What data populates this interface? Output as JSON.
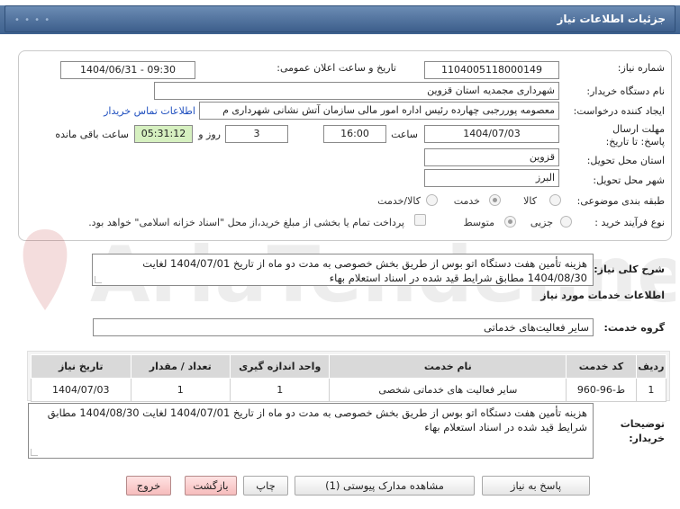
{
  "header": {
    "title": "جزئیات اطلاعات نیاز"
  },
  "fields": {
    "need_number_label": "شماره نیاز:",
    "need_number": "1104005118000149",
    "announce_label": "تاریخ و ساعت اعلان عمومی:",
    "announce_value": "1404/06/31 - 09:30",
    "buyer_org_label": "نام دستگاه خریدار:",
    "buyer_org": "شهرداری مجمدیه استان قزوین",
    "creator_label": "ایجاد کننده درخواست:",
    "creator": "معصومه پوررجبی چهارده رئیس اداره امور مالی سازمان آتش نشانی شهرداری م",
    "contact_link": "اطلاعات تماس خریدار",
    "deadline_label": "مهلت ارسال پاسخ: تا تاریخ:",
    "deadline_date": "1404/07/03",
    "time_label": "ساعت",
    "deadline_time": "16:00",
    "days_value": "3",
    "days_label": "روز و",
    "remaining_time": "05:31:12",
    "remaining_label": "ساعت باقی مانده",
    "province_label": "استان محل تحویل:",
    "province": "قزوین",
    "city_label": "شهر محل تحویل:",
    "city": "البرز",
    "category_label": "طبقه بندی موضوعی:",
    "category_options": [
      "کالا",
      "خدمت",
      "کالا/خدمت"
    ],
    "process_label": "نوع فرآیند خرید :",
    "process_options": [
      "جزیی",
      "متوسط"
    ],
    "payment_note": "پرداخت تمام یا بخشی از مبلغ خرید،از محل \"اسناد خزانه اسلامی\" خواهد بود."
  },
  "summary": {
    "label": "شرح کلی نیاز:",
    "text": "هزینه تأمین هفت دستگاه اتو بوس از طریق بخش خصوصی به مدت دو ماه از تاریخ 1404/07/01 لغایت 1404/08/30 مطابق شرایط قید شده در اسناد استعلام بهاء"
  },
  "services": {
    "title": "اطلاعات خدمات مورد نیاز",
    "group_label": "گروه خدمت:",
    "group_value": "سایر فعالیت‌های خدماتی",
    "columns": [
      "ردیف",
      "کد خدمت",
      "نام خدمت",
      "واحد اندازه گیری",
      "تعداد / مقدار",
      "تاریخ نیاز"
    ],
    "rows": [
      [
        "1",
        "ط-96-960",
        "سایر فعالیت های خدماتی شخصی",
        "1",
        "1",
        "1404/07/03"
      ]
    ]
  },
  "buyer_notes": {
    "label": "توضیحات خریدار:",
    "text": "هزینه تأمین هفت دستگاه اتو بوس از طریق بخش خصوصی به مدت دو ماه از تاریخ 1404/07/01 لغایت 1404/08/30 مطابق شرایط قید شده در اسناد استعلام بهاء"
  },
  "buttons": {
    "reply": "پاسخ به نیاز",
    "attachments": "مشاهده مدارک پیوستی (1)",
    "print": "چاپ",
    "back": "بازگشت",
    "exit": "خروج"
  },
  "watermark": {
    "text": "AriaTender.net"
  },
  "colors": {
    "header": "#4a6a96",
    "accent_green": "#d6f0c0",
    "danger": "#f6bcbc",
    "link": "#1f4fbf"
  }
}
